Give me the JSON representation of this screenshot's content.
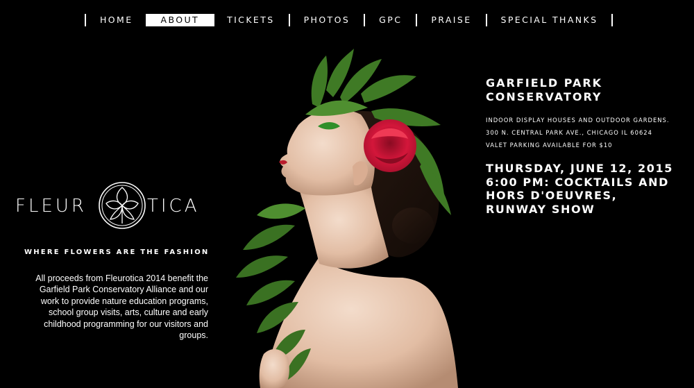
{
  "nav": {
    "items": [
      {
        "label": "HOME",
        "active": false
      },
      {
        "label": "ABOUT",
        "active": true
      },
      {
        "label": "TICKETS",
        "active": false
      },
      {
        "label": "PHOTOS",
        "active": false
      },
      {
        "label": "GPC",
        "active": false
      },
      {
        "label": "PRAISE",
        "active": false
      },
      {
        "label": "SPECIAL THANKS",
        "active": false
      }
    ]
  },
  "brand": {
    "name_left": "FLEUR",
    "name_right": "TICA",
    "seal_icon": "flower-seal-icon",
    "tagline": "WHERE FLOWERS ARE THE FASHION",
    "proceeds": "All proceeds from Fleurotica 2014 benefit the Garfield Park Conservatory Alliance and our work to provide nature education programs, school group visits, arts, culture and early childhood programming for our visitors and groups."
  },
  "venue": {
    "line1": "GARFIELD PARK",
    "line2": "CONSERVATORY",
    "detail1": "INDOOR DISPLAY HOUSES AND OUTDOOR GARDENS.",
    "detail2": "300 N. CENTRAL PARK AVE., CHICAGO IL 60624",
    "detail3": "VALET PARKING AVAILABLE FOR $10"
  },
  "event": {
    "line1": "THURSDAY, JUNE 12, 2015",
    "line2": "6:00 PM: COCKTAILS AND",
    "line3": "HORS D'OEUVRES,",
    "line4": "RUNWAY SHOW"
  },
  "colors": {
    "background": "#000000",
    "text": "#ffffff",
    "rose": "#d3163a",
    "leaf": "#3f7a25"
  }
}
